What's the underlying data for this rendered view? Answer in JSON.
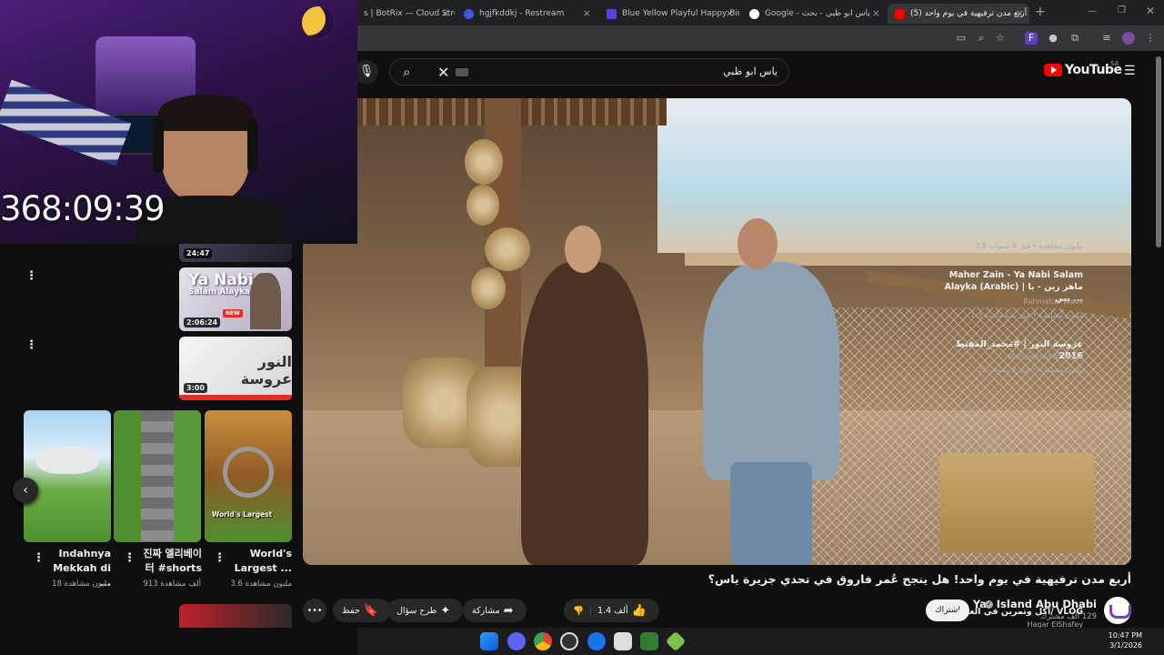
{
  "browser": {
    "tabs": [
      {
        "label": "s | BotRix — Cloud Stre",
        "fav_color": "#4285f4"
      },
      {
        "label": "hgjfkddkj - Restream",
        "fav_color": "#3b5bdb"
      },
      {
        "label": "Blue Yellow Playful Happy Birth",
        "fav_color": "#4f46e5"
      },
      {
        "label": "Google - ياس ابو ظبي - بحث",
        "fav_color": "#ffffff"
      },
      {
        "label": "أربع مدن ترفيهية في يوم واحد (5)",
        "fav_color": "#ff0000",
        "active": true
      }
    ],
    "new_tab": "+",
    "close": "×"
  },
  "youtube": {
    "search_value": "ياس ابو ظبي",
    "logo_text": "YouTube",
    "region": "SA"
  },
  "video": {
    "title": "أربع مدن ترفيهية في يوم واحد! هل ينجح عُمر فاروق في تحدي جزيرة ياس؟",
    "channel": "Yas Island Abu Dhabi",
    "subscribers": "129 ألف مشترك",
    "subscribe": "اشتراك",
    "likes": "1.4 ألف",
    "share": "مشاركة",
    "ask": "طرح سؤال",
    "save": "حفظ"
  },
  "recommendations": [
    {
      "meta": "2.8 مليون مشاهدة • قبل 4 سنوات",
      "duration": "24:47"
    },
    {
      "title": "Maher Zain - Ya Nabi Salam Alayka (Arabic) | ماهر زين - يا نبي ...",
      "channel": "Rahmatun Wave",
      "meta": "1.3 مليون مشاهدة • قبل سنة واحدة",
      "duration": "2:06:24",
      "thumb_title": "Ya Nabi",
      "thumb_sub": "Salam Alayka",
      "badge": "NEW"
    },
    {
      "title": "عروسة النور | #محمد_المقيط 2016",
      "channel": "Muhammad Al Muqit",
      "meta": "26 مليون مشاهدة • قبل 9 سنوات",
      "duration": "3:00",
      "thumb_title": "النور عروسة"
    }
  ],
  "shorts": [
    {
      "title": "Indahnya Mekkah di ...",
      "meta": "18 مليون مشاهدة"
    },
    {
      "title": "진짜 엘리베이터 #shorts",
      "meta": "913 ألف مشاهدة"
    },
    {
      "title": "World's Largest ...",
      "meta": "3.6 مليون مشاهدة",
      "thumb_text": "World's Largest"
    }
  ],
  "next_rec": {
    "title": "اكل وتمرين في الغربة/ VLOG",
    "channel": "Hagar ElShafey"
  },
  "overlay": {
    "timer": "368:09:39"
  },
  "taskbar": {
    "time": "10:47 PM",
    "date": "3/1/2026"
  }
}
